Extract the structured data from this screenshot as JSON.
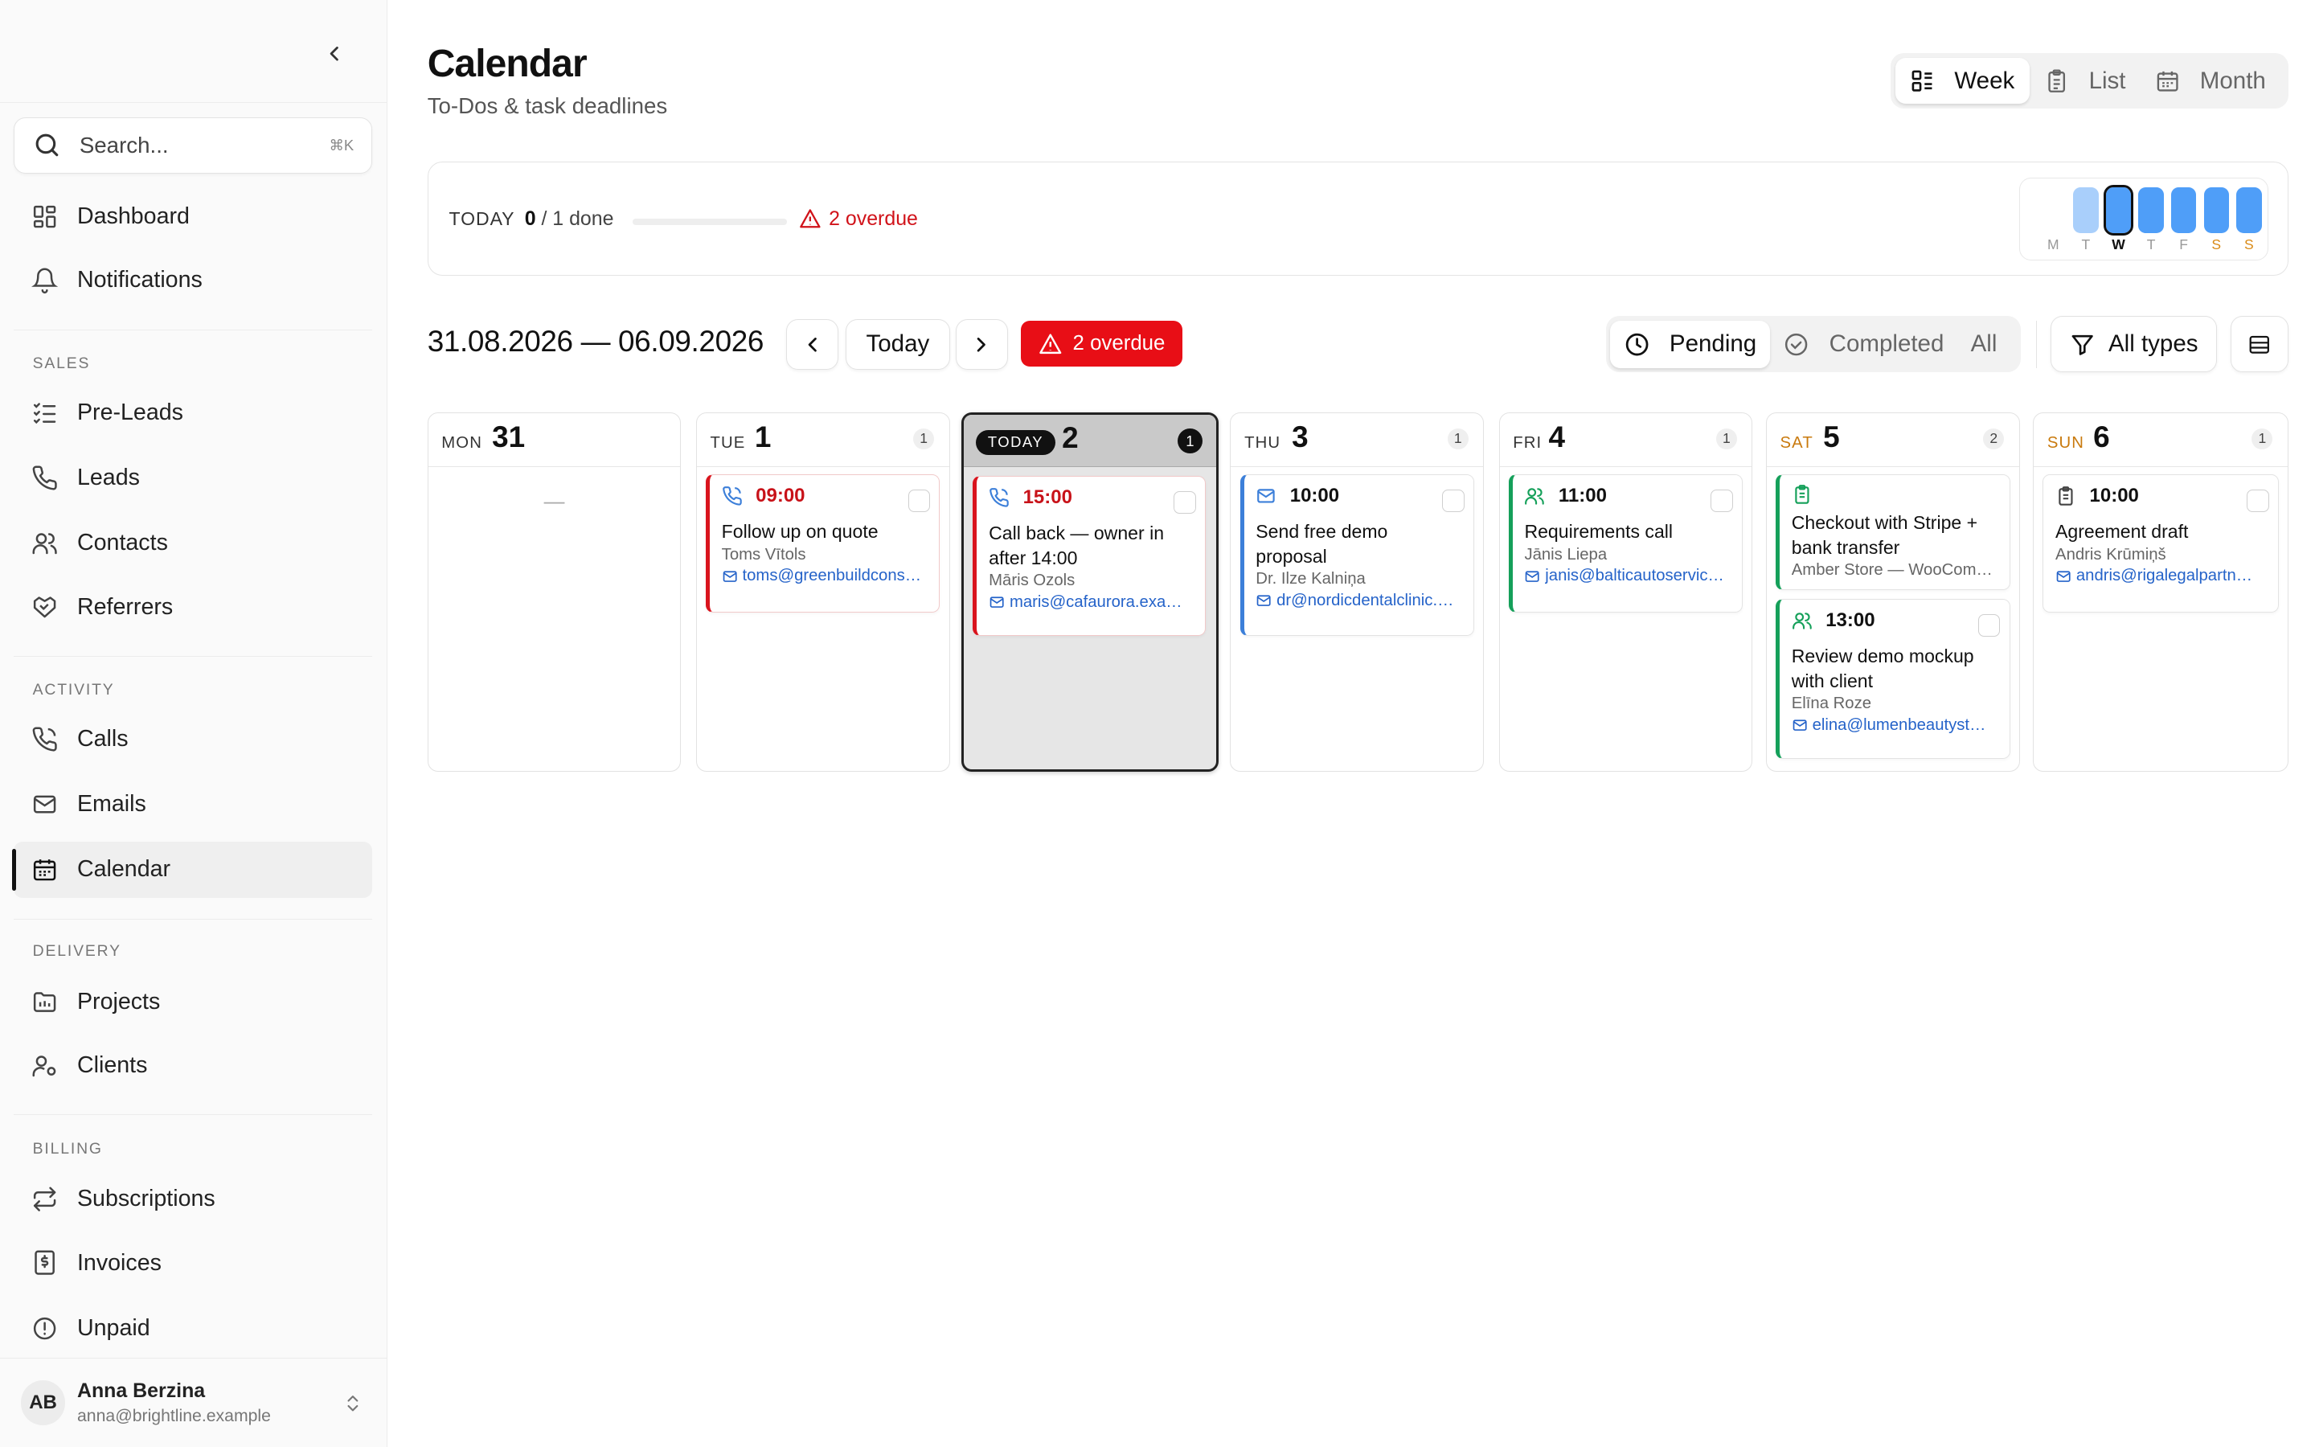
{
  "sidebar": {
    "search": {
      "placeholder": "Search...",
      "shortcut": "⌘K"
    },
    "items": [
      {
        "label": "Dashboard"
      },
      {
        "label": "Notifications"
      },
      {
        "label": "Pre-Leads"
      },
      {
        "label": "Leads"
      },
      {
        "label": "Contacts"
      },
      {
        "label": "Referrers"
      },
      {
        "label": "Calls"
      },
      {
        "label": "Emails"
      },
      {
        "label": "Calendar"
      },
      {
        "label": "Projects"
      },
      {
        "label": "Clients"
      },
      {
        "label": "Subscriptions"
      },
      {
        "label": "Invoices"
      },
      {
        "label": "Unpaid"
      }
    ],
    "sections": {
      "sales": "SALES",
      "activity": "ACTIVITY",
      "delivery": "DELIVERY",
      "billing": "BILLING"
    },
    "active_item": "Calendar",
    "user": {
      "initials": "AB",
      "name": "Anna Berzina",
      "email": "anna@brightline.example"
    }
  },
  "header": {
    "title": "Calendar",
    "subtitle": "To-Dos & task deadlines",
    "views": [
      {
        "label": "Week"
      },
      {
        "label": "List"
      },
      {
        "label": "Month"
      }
    ],
    "active_view": "Week"
  },
  "summary": {
    "today_label": "TODAY",
    "done": "0",
    "total_text": "/ 1 done",
    "progress": 0,
    "overdue": "2 overdue",
    "mini_week_labels": [
      "M",
      "T",
      "W",
      "T",
      "F",
      "S",
      "S"
    ]
  },
  "toolbar": {
    "range": "31.08.2026 — 06.09.2026",
    "today_button": "Today",
    "overdue_button": "2 overdue",
    "status": [
      {
        "label": "Pending"
      },
      {
        "label": "Completed"
      },
      {
        "label": "All"
      }
    ],
    "active_status": "Pending",
    "types_filter": "All types"
  },
  "week": [
    {
      "dow": "MON",
      "num": "31",
      "count": "",
      "empty": "—",
      "tasks": []
    },
    {
      "dow": "TUE",
      "num": "1",
      "count": "1",
      "tasks": [
        {
          "time": "09:00",
          "title": "Follow up on quote",
          "person": "Toms Vītols",
          "email": "toms@greenbuildcons…"
        }
      ]
    },
    {
      "dow": "TODAY",
      "num": "2",
      "count": "1",
      "tasks": [
        {
          "time": "15:00",
          "title": "Call back — owner in after 14:00",
          "person": "Māris Ozols",
          "email": "maris@cafaurora.exa…"
        }
      ]
    },
    {
      "dow": "THU",
      "num": "3",
      "count": "1",
      "tasks": [
        {
          "time": "10:00",
          "title": "Send free demo proposal",
          "person": "Dr. Ilze Kalniņa",
          "email": "dr@nordicdentalclinic.…"
        }
      ]
    },
    {
      "dow": "FRI",
      "num": "4",
      "count": "1",
      "tasks": [
        {
          "time": "11:00",
          "title": "Requirements call",
          "person": "Jānis Liepa",
          "email": "janis@balticautoservic…"
        }
      ]
    },
    {
      "dow": "SAT",
      "num": "5",
      "count": "2",
      "tasks": [
        {
          "time": "",
          "title": "Checkout with Stripe + bank transfer",
          "person": "Amber Store — WooCom…",
          "email": ""
        },
        {
          "time": "13:00",
          "title": "Review demo mockup with client",
          "person": "Elīna Roze",
          "email": "elina@lumenbeautyst…"
        }
      ]
    },
    {
      "dow": "SUN",
      "num": "6",
      "count": "1",
      "tasks": [
        {
          "time": "10:00",
          "title": "Agreement draft",
          "person": "Andris Krūmiņš",
          "email": "andris@rigalegalpartn…"
        }
      ]
    }
  ],
  "colors": {
    "overdue_red": "#e80e16",
    "call_red": "#d9141d",
    "email_blue": "#3c7fd9",
    "meeting_green": "#15a05a",
    "weekend_orange": "#c97a0e"
  }
}
